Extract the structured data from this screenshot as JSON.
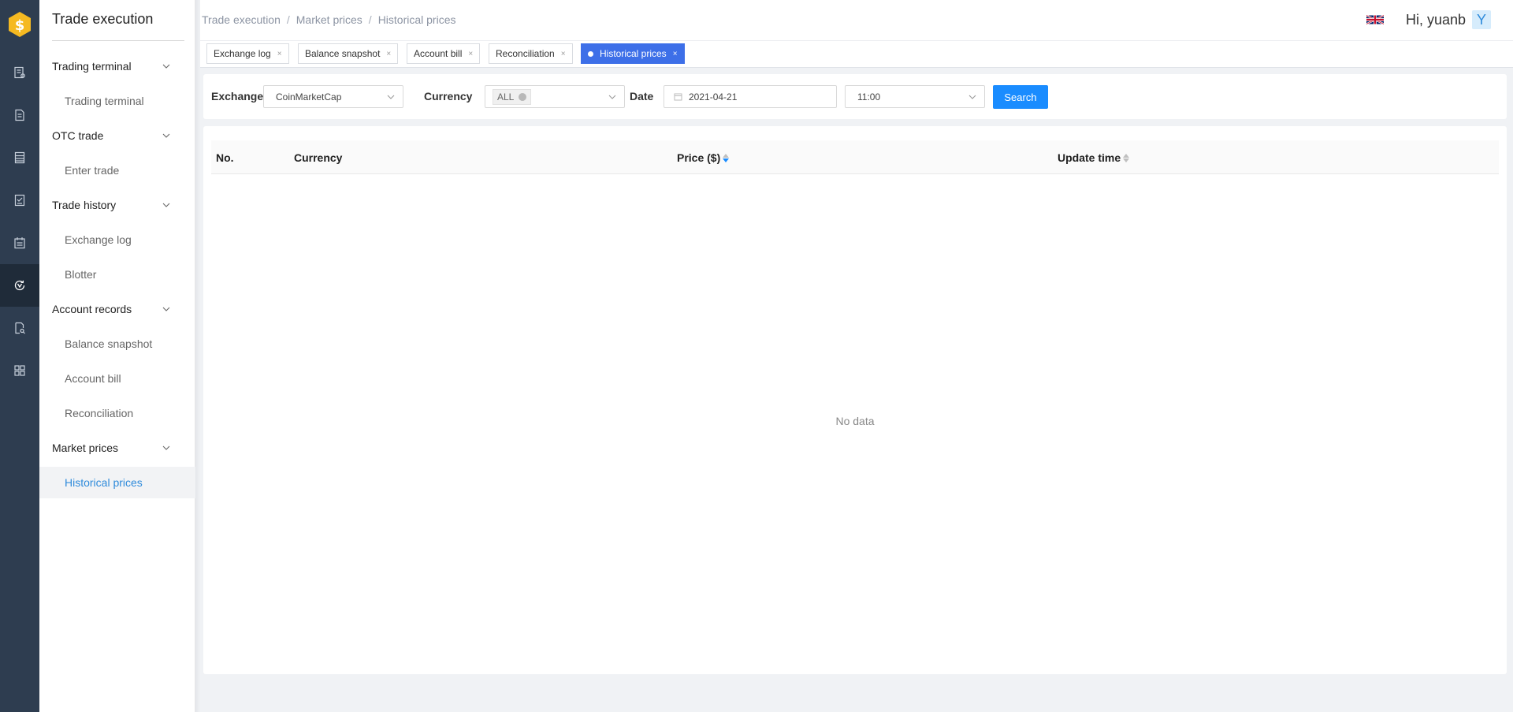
{
  "app": {
    "title": "Trade execution"
  },
  "rail": {
    "items": [
      {
        "icon": "report-icon"
      },
      {
        "icon": "document-icon"
      },
      {
        "icon": "ledger-icon"
      },
      {
        "icon": "receipt-icon"
      },
      {
        "icon": "calendar-icon"
      },
      {
        "icon": "price-history-icon",
        "active": true
      },
      {
        "icon": "file-search-icon"
      },
      {
        "icon": "apps-grid-icon"
      }
    ]
  },
  "sidebar": {
    "groups": [
      {
        "label": "Trading terminal",
        "items": [
          "Trading terminal"
        ]
      },
      {
        "label": "OTC trade",
        "items": [
          "Enter trade"
        ]
      },
      {
        "label": "Trade history",
        "items": [
          "Exchange log",
          "Blotter"
        ]
      },
      {
        "label": "Account records",
        "items": [
          "Balance snapshot",
          "Account bill",
          "Reconciliation"
        ]
      },
      {
        "label": "Market prices",
        "items": [
          "Historical prices"
        ]
      }
    ],
    "active_item": "Historical prices"
  },
  "header": {
    "breadcrumb": [
      "Trade execution",
      "Market prices",
      "Historical prices"
    ],
    "separator": "/",
    "greeting": "Hi, yuanb",
    "avatar_letter": "Y",
    "language_icon": "uk-flag-icon"
  },
  "tabs": [
    {
      "label": "Exchange log",
      "close": "×"
    },
    {
      "label": "Balance snapshot",
      "close": "×"
    },
    {
      "label": "Account bill",
      "close": "×"
    },
    {
      "label": "Reconciliation",
      "close": "×"
    },
    {
      "label": "Historical prices",
      "close": "×",
      "active": true
    }
  ],
  "filters": {
    "exchange_label": "Exchange",
    "exchange_value": "CoinMarketCap",
    "currency_label": "Currency",
    "currency_value": "ALL",
    "date_label": "Date",
    "date_value": "2021-04-21",
    "time_value": "11:00",
    "search_label": "Search"
  },
  "table": {
    "columns": [
      "No.",
      "Currency",
      "Price ($)",
      "Update time"
    ],
    "rows": [],
    "empty_text": "No data"
  },
  "colors": {
    "rail_bg": "#2e3d50",
    "accent": "#1a8cff",
    "active_tab": "#3d6fe8",
    "active_menu_text": "#2f8bdb"
  }
}
